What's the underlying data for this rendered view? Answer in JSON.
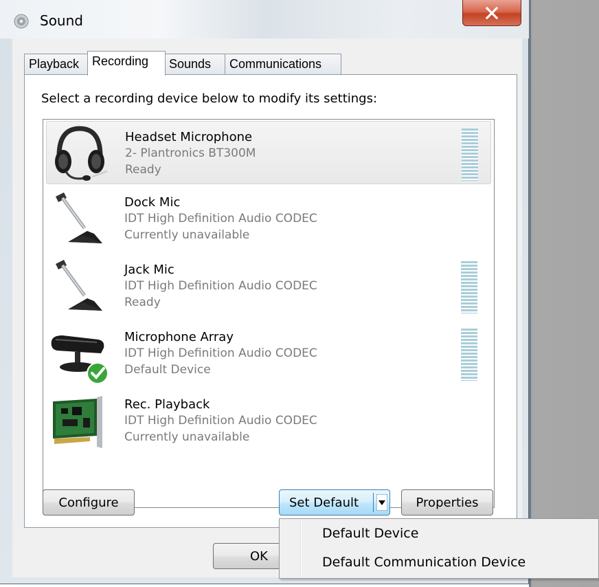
{
  "window": {
    "title": "Sound",
    "close_icon": "close-icon"
  },
  "tabs": [
    {
      "label": "Playback",
      "active": false
    },
    {
      "label": "Recording",
      "active": true
    },
    {
      "label": "Sounds",
      "active": false
    },
    {
      "label": "Communications",
      "active": false
    }
  ],
  "instruction": "Select a recording device below to modify its settings:",
  "devices": [
    {
      "name": "Headset Microphone",
      "driver": "2- Plantronics BT300M",
      "status": "Ready",
      "icon": "headset-icon",
      "selected": true,
      "level_meter": true
    },
    {
      "name": "Dock Mic",
      "driver": "IDT High Definition Audio CODEC",
      "status": "Currently unavailable",
      "icon": "microphone-stand-icon",
      "selected": false,
      "level_meter": false
    },
    {
      "name": "Jack Mic",
      "driver": "IDT High Definition Audio CODEC",
      "status": "Ready",
      "icon": "microphone-stand-icon",
      "selected": false,
      "level_meter": true
    },
    {
      "name": "Microphone Array",
      "driver": "IDT High Definition Audio CODEC",
      "status": "Default Device",
      "icon": "webcam-mic-icon",
      "selected": false,
      "level_meter": true,
      "default_badge": "green-check-icon"
    },
    {
      "name": "Rec. Playback",
      "driver": "IDT High Definition Audio CODEC",
      "status": "Currently unavailable",
      "icon": "sound-card-icon",
      "selected": false,
      "level_meter": false
    }
  ],
  "buttons": {
    "configure": "Configure",
    "set_default": "Set Default",
    "properties": "Properties",
    "ok": "OK"
  },
  "dropdown": {
    "items": [
      "Default Device",
      "Default Communication Device"
    ]
  },
  "colors": {
    "selection_bg": "#ececec",
    "level_meter": "#a9cdd9",
    "split_button": "#bee6fd",
    "close_button": "#c24324"
  }
}
